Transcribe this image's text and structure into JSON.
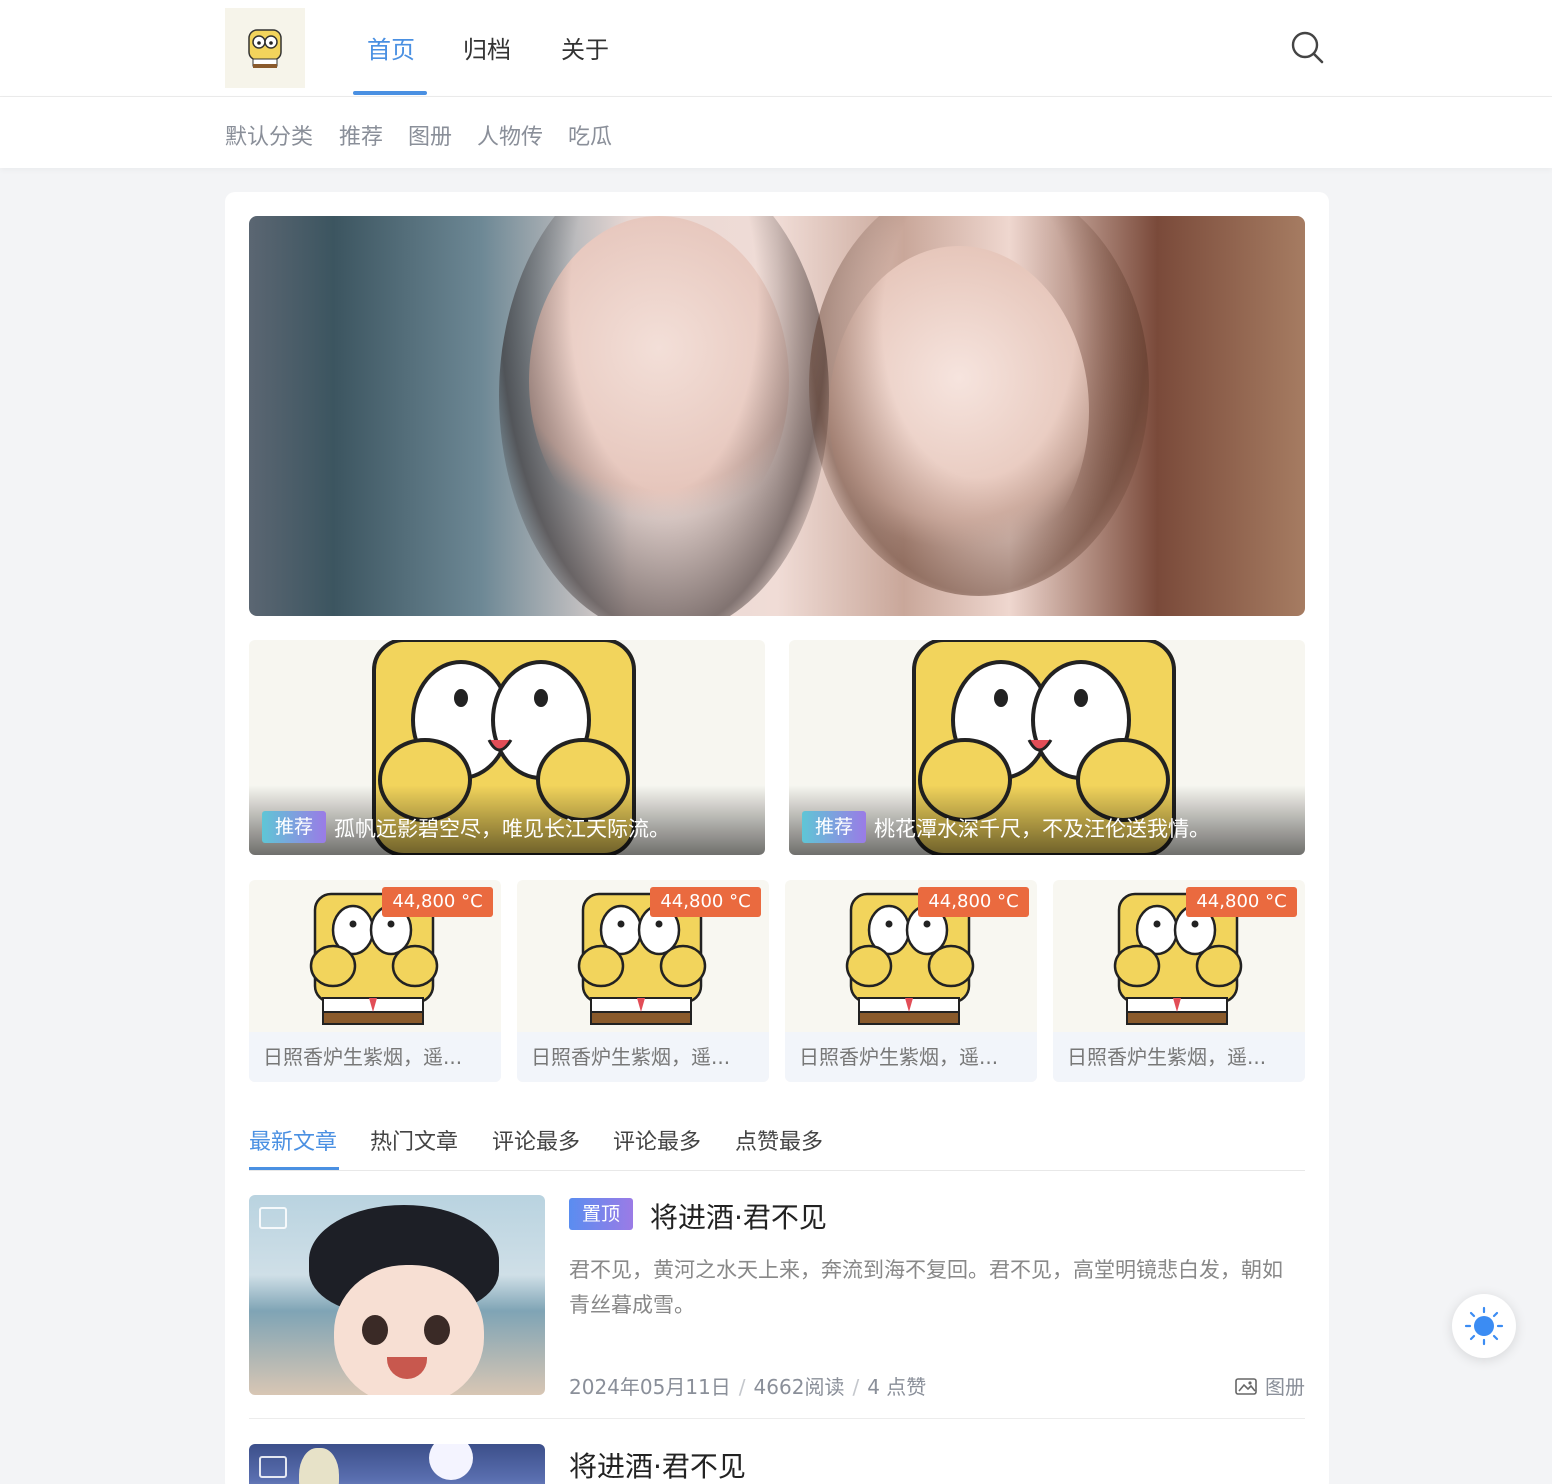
{
  "nav": {
    "items": [
      {
        "label": "首页",
        "active": true
      },
      {
        "label": "归档",
        "active": false
      },
      {
        "label": "关于",
        "active": false
      }
    ]
  },
  "categories": [
    "默认分类",
    "推荐",
    "图册",
    "人物传",
    "吃瓜"
  ],
  "features": [
    {
      "tag": "推荐",
      "title": "孤帆远影碧空尽，唯见长江天际流。"
    },
    {
      "tag": "推荐",
      "title": "桃花潭水深千尺，不及汪伦送我情。"
    }
  ],
  "minis": [
    {
      "badge": "44,800 °C",
      "caption": "日照香炉生紫烟，遥..."
    },
    {
      "badge": "44,800 °C",
      "caption": "日照香炉生紫烟，遥..."
    },
    {
      "badge": "44,800 °C",
      "caption": "日照香炉生紫烟，遥..."
    },
    {
      "badge": "44,800 °C",
      "caption": "日照香炉生紫烟，遥..."
    }
  ],
  "tabs": [
    "最新文章",
    "热门文章",
    "评论最多",
    "评论最多",
    "点赞最多"
  ],
  "posts": [
    {
      "pin": "置顶",
      "title": "将进酒·君不见",
      "excerpt": "君不见，黄河之水天上来，奔流到海不复回。君不见，高堂明镜悲白发，朝如青丝暮成雪。",
      "date": "2024年05月11日",
      "reads": "4662阅读",
      "likes": "4 点赞",
      "category": "图册"
    },
    {
      "title": "将进酒·君不见"
    }
  ],
  "colors": {
    "accent": "#4a90e2",
    "badge": "#ea6a3f"
  }
}
